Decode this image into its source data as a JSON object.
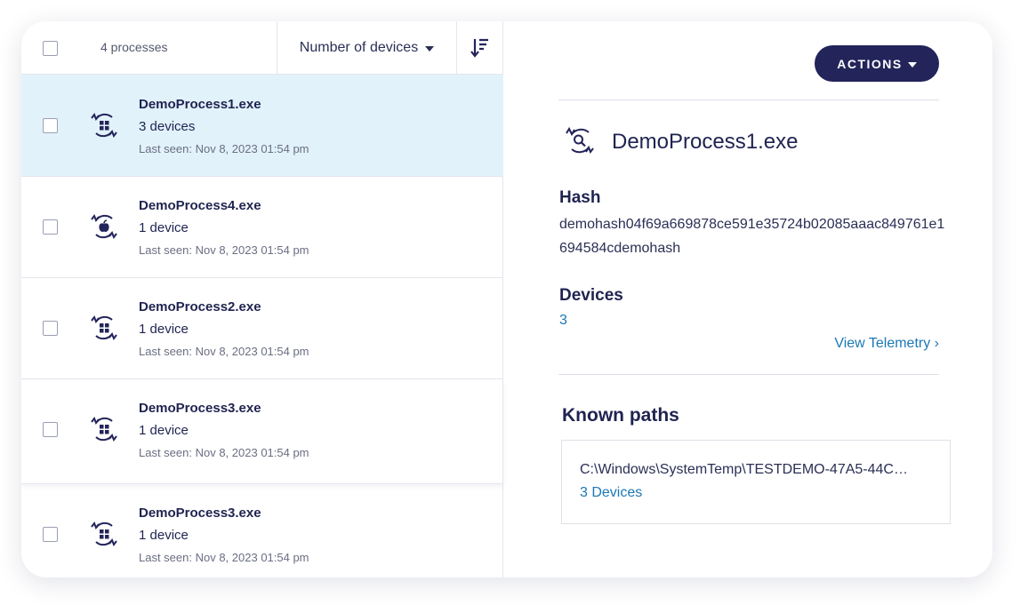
{
  "list": {
    "count_label": "4 processes",
    "sort_label": "Number of devices",
    "rows": [
      {
        "name": "DemoProcess1.exe",
        "devices": "3 devices",
        "last_seen": "Last seen: Nov 8, 2023 01:54 pm",
        "icon": "windows-process-icon",
        "selected": true
      },
      {
        "name": "DemoProcess4.exe",
        "devices": "1 device",
        "last_seen": "Last seen: Nov 8, 2023 01:54 pm",
        "icon": "apple-process-icon",
        "selected": false
      },
      {
        "name": "DemoProcess2.exe",
        "devices": "1 device",
        "last_seen": "Last seen: Nov 8, 2023 01:54 pm",
        "icon": "windows-process-icon",
        "selected": false
      },
      {
        "name": "DemoProcess3.exe",
        "devices": "1 device",
        "last_seen": "Last seen: Nov 8, 2023 01:54 pm",
        "icon": "windows-process-icon",
        "selected": false
      },
      {
        "name": "DemoProcess3.exe",
        "devices": "1 device",
        "last_seen": "Last seen: Nov 8, 2023 01:54 pm",
        "icon": "windows-process-icon",
        "selected": false
      }
    ]
  },
  "detail": {
    "actions_label": "ACTIONS",
    "title": "DemoProcess1.exe",
    "hash_label": "Hash",
    "hash_value": "demohash04f69a669878ce591e35724b02085aaac849761e1694584cdemohash",
    "devices_label": "Devices",
    "devices_value": "3",
    "telemetry_link": "View Telemetry ›",
    "known_paths_label": "Known paths",
    "known_paths": [
      {
        "path": "C:\\Windows\\SystemTemp\\TESTDEMO-47A5-44C…",
        "devices": "3 Devices"
      }
    ]
  },
  "colors": {
    "accent_dark": "#23245a",
    "link": "#1b78b4",
    "selected_row": "#e2f2fb"
  }
}
